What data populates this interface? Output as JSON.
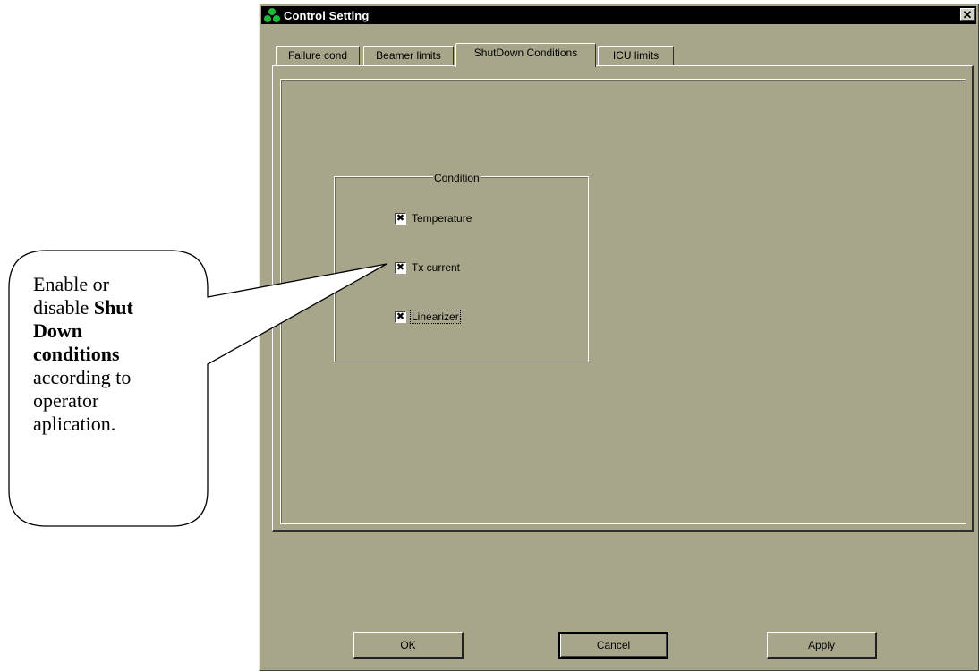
{
  "window": {
    "title": "Control Setting",
    "close_glyph": "✕"
  },
  "tabs": [
    {
      "label": "Failure cond",
      "active": false
    },
    {
      "label": "Beamer limits",
      "active": false
    },
    {
      "label": "ShutDown Conditions",
      "active": true
    },
    {
      "label": "ICU limits",
      "active": false
    }
  ],
  "group": {
    "title": "Condition",
    "items": [
      {
        "label": "Temperature",
        "checked": true
      },
      {
        "label": "Tx current",
        "checked": true
      },
      {
        "label": "Linearizer",
        "checked": true
      }
    ]
  },
  "buttons": {
    "ok": "OK",
    "cancel": "Cancel",
    "apply": "Apply"
  },
  "callout": {
    "line1": "Enable or",
    "line2_prefix": "disable ",
    "line2_bold": "Shut",
    "line3_bold": "Down",
    "line4_bold": "conditions",
    "line5": "according to",
    "line6": "operator",
    "line7": "aplication."
  },
  "colors": {
    "dialog_bg": "#a7a68b",
    "titlebar_bg": "#000000",
    "icon_green": "#1fb83b"
  }
}
